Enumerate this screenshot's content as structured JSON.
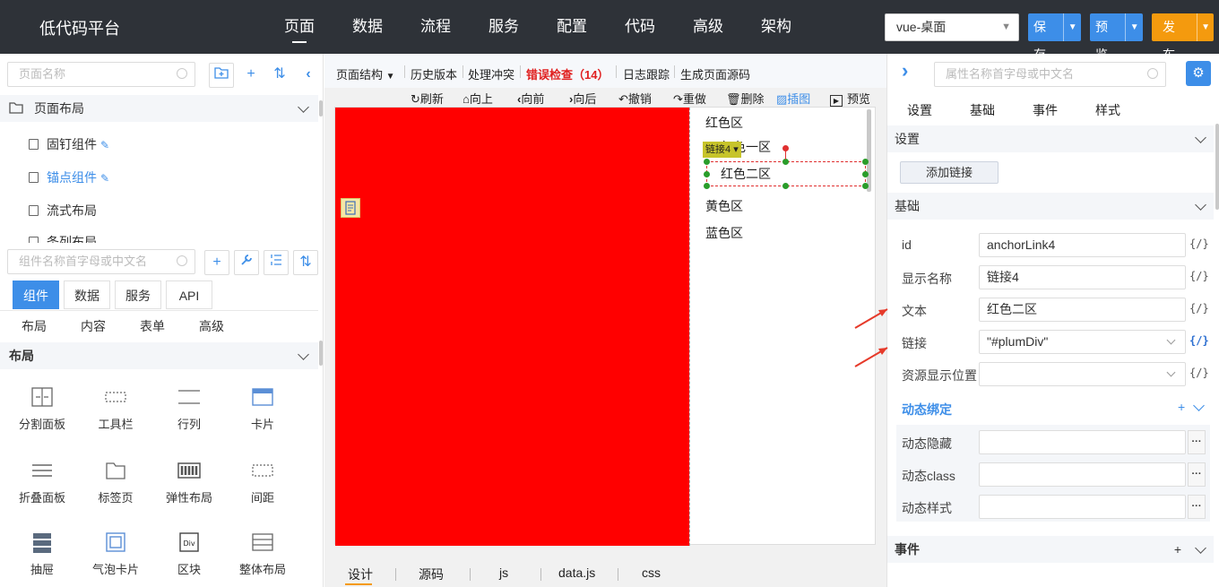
{
  "header": {
    "brand": "低代码平台",
    "nav": [
      "页面",
      "数据",
      "流程",
      "服务",
      "配置",
      "代码",
      "高级",
      "架构"
    ],
    "app_select": "vue-桌面",
    "save": "保存",
    "preview": "预览",
    "publish": "发布"
  },
  "left": {
    "page_search_placeholder": "页面名称",
    "tree_root": "页面布局",
    "tree_items": [
      "固钉组件",
      "锚点组件",
      "流式布局",
      "条列布局"
    ],
    "component_search_placeholder": "组件名称首字母或中文名",
    "tabs": [
      "组件",
      "数据",
      "服务",
      "API"
    ],
    "categories": [
      "布局",
      "内容",
      "表单",
      "高级"
    ],
    "section": "布局",
    "components": [
      "分割面板",
      "工具栏",
      "行列",
      "卡片",
      "折叠面板",
      "标签页",
      "弹性布局",
      "间距",
      "抽屉",
      "气泡卡片",
      "区块",
      "整体布局"
    ]
  },
  "center": {
    "toolbar": [
      "页面结构",
      "历史版本",
      "处理冲突",
      "错误检查（14）",
      "日志跟踪",
      "生成页面源码"
    ],
    "actions": [
      "刷新",
      "向上",
      "向前",
      "向后",
      "撤销",
      "重做",
      "删除",
      "插图",
      "预览"
    ],
    "anchors": [
      "红色区",
      "红色一区",
      "红色二区",
      "黄色区",
      "蓝色区"
    ],
    "selected_tag": "链接4",
    "bottom_tabs": [
      "设计",
      "源码",
      "js",
      "data.js",
      "css"
    ]
  },
  "right": {
    "search_placeholder": "属性名称首字母或中文名",
    "tabs": [
      "设置",
      "基础",
      "事件",
      "样式"
    ],
    "settings_section": "设置",
    "add_link": "添加链接",
    "basic_section": "基础",
    "fields": [
      {
        "label": "id",
        "value": "anchorLink4",
        "code": "{/}"
      },
      {
        "label": "显示名称",
        "value": "链接4",
        "code": "{/}"
      },
      {
        "label": "文本",
        "value": "红色二区",
        "code": "{/}"
      },
      {
        "label": "链接",
        "value": "\"#plumDiv\"",
        "code": "{/}"
      },
      {
        "label": "资源显示位置",
        "value": "",
        "code": "{/}"
      }
    ],
    "dynamic_section": "动态绑定",
    "dynamic_fields": [
      "动态隐藏",
      "动态class",
      "动态样式"
    ],
    "events_section": "事件"
  },
  "colors": {
    "topbar": "#2e3238",
    "accent": "#3d8ee8",
    "publish": "#f49a0e",
    "error": "#e02020",
    "canvas_block": "#ff0000"
  }
}
